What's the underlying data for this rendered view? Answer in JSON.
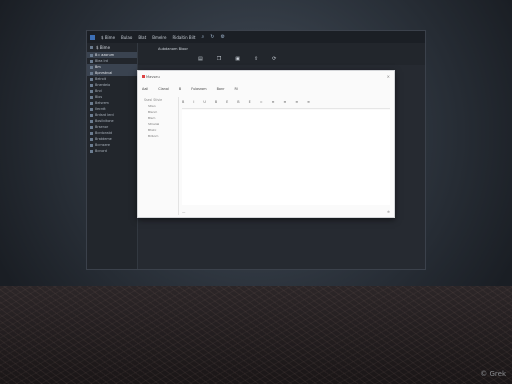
{
  "window": {
    "title_items": [
      "$ Bime",
      "Bulao",
      "Blat",
      "Bmelre",
      "Ridaitin Bilt"
    ],
    "title_icons": [
      "search-icon",
      "refresh-icon",
      "settings-icon",
      "gear-icon"
    ]
  },
  "sidebar": {
    "header": "$ Bime",
    "items": [
      {
        "label": "B= azorum",
        "selected": true
      },
      {
        "label": "Blea lrd",
        "selected": false
      },
      {
        "label": "Bm",
        "selected": true
      },
      {
        "label": "Bpnrstrcal",
        "selected": true
      },
      {
        "label": "Belroit",
        "selected": false
      },
      {
        "label": "Bnerdeio",
        "selected": false
      },
      {
        "label": "Bnd",
        "selected": false
      },
      {
        "label": "Blos",
        "selected": false
      },
      {
        "label": "Belsrem",
        "selected": false
      },
      {
        "label": "Ilecrdt",
        "selected": false
      },
      {
        "label": "Brdsrd lerd",
        "selected": false
      },
      {
        "label": "Bosilvitone",
        "selected": false
      },
      {
        "label": "Brsenor",
        "selected": false
      },
      {
        "label": "Bcrdonstd",
        "selected": false
      },
      {
        "label": "Bratdeme",
        "selected": false
      },
      {
        "label": "Bcrnsere",
        "selected": false
      },
      {
        "label": "Bcnord",
        "selected": false
      }
    ]
  },
  "appbar": {
    "breadcrumb": "Aubdanom Bioor",
    "toolbar_icons": [
      "document-icon",
      "copy-icon",
      "image-icon",
      "share-icon",
      "sync-icon"
    ]
  },
  "dialog": {
    "title": "Mavseu",
    "close_label": "×",
    "toolbar": [
      "Aail",
      "Clanal",
      "B",
      "Fulasrom",
      "Bonr",
      "Rl"
    ],
    "left_header": "Ssesl Stlvie",
    "left_items": [
      "Stlan",
      "Blsnm",
      "Blsm",
      "Stlrelial",
      "Bhstc",
      "Bilbom"
    ],
    "format_items": [
      "B",
      "I",
      "U",
      "B",
      "E",
      "B",
      "E",
      "=",
      "≡",
      "≡",
      "≡",
      "≡"
    ],
    "status_left": "—",
    "status_right": "⊕"
  },
  "watermark": "© Grek"
}
